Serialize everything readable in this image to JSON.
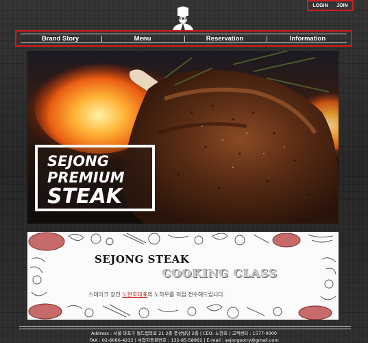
{
  "header": {
    "login_label": "LOGIN",
    "join_label": "JOIN",
    "logo_icon": "chef-icon"
  },
  "nav": {
    "items": [
      {
        "label": "Brand Story"
      },
      {
        "label": "Menu"
      },
      {
        "label": "Reservation"
      },
      {
        "label": "Information"
      }
    ]
  },
  "hero": {
    "line1": "SEJONG",
    "line2": "PREMIUM",
    "line3": "STEAK"
  },
  "banner": {
    "title1": "SEJONG STEAK",
    "title2": "COOKING CLASS",
    "desc_pre": "스테이크 장인 ",
    "desc_highlight": "노현호대표",
    "desc_post": "의 노하우를 직접 전수해드립니다."
  },
  "footer": {
    "line1": "Address : 서울 마포구 월드컵북로 21 2층 풍성빌딩 2층 | CEO: 노현호 | 고객센터 : 1577-0000",
    "line2": "FAX : 02-6666-4232 | 사업자등록번호 : 132-85-58962 | E-mail : sejongsorry@gmail.com"
  },
  "colors": {
    "accent": "#d21c1c",
    "background": "#2b2b2b"
  }
}
